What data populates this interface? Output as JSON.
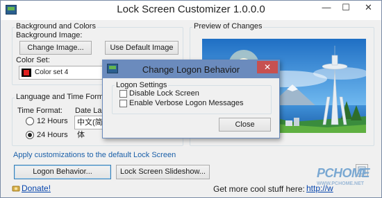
{
  "window": {
    "title": "Lock Screen Customizer 1.0.0.0",
    "minimize": "—",
    "maximize": "☐",
    "close": "✕"
  },
  "background_group": {
    "title": "Background and Colors",
    "image_label": "Background Image:",
    "change_image": "Change Image...",
    "use_default_image": "Use Default Image",
    "color_set_label": "Color Set:",
    "color_set_value": "Color set 4"
  },
  "preview_group": {
    "title": "Preview of Changes"
  },
  "lang_group": {
    "title": "Language and Time Format",
    "time_format_label": "Time Format:",
    "hours12": "12 Hours",
    "hours24": "24 Hours",
    "date_label": "Date Lang",
    "date_value": "中文(简体"
  },
  "apply_text": "Apply customizations to the default Lock Screen",
  "buttons": {
    "logon_behavior": "Logon Behavior...",
    "slideshow": "Lock Screen Slideshow..."
  },
  "footer": {
    "donate": "Donate!",
    "more": "Get more cool stuff here:",
    "url": "http://w"
  },
  "dialog": {
    "title": "Change Logon Behavior",
    "close": "✕",
    "group_title": "Logon Settings",
    "disable_lock": "Disable Lock Screen",
    "verbose": "Enable Verbose Logon Messages",
    "close_button": "Close"
  },
  "watermark": {
    "line1": "PCHOME",
    "line2": "WWW.PCHOME.NET"
  }
}
